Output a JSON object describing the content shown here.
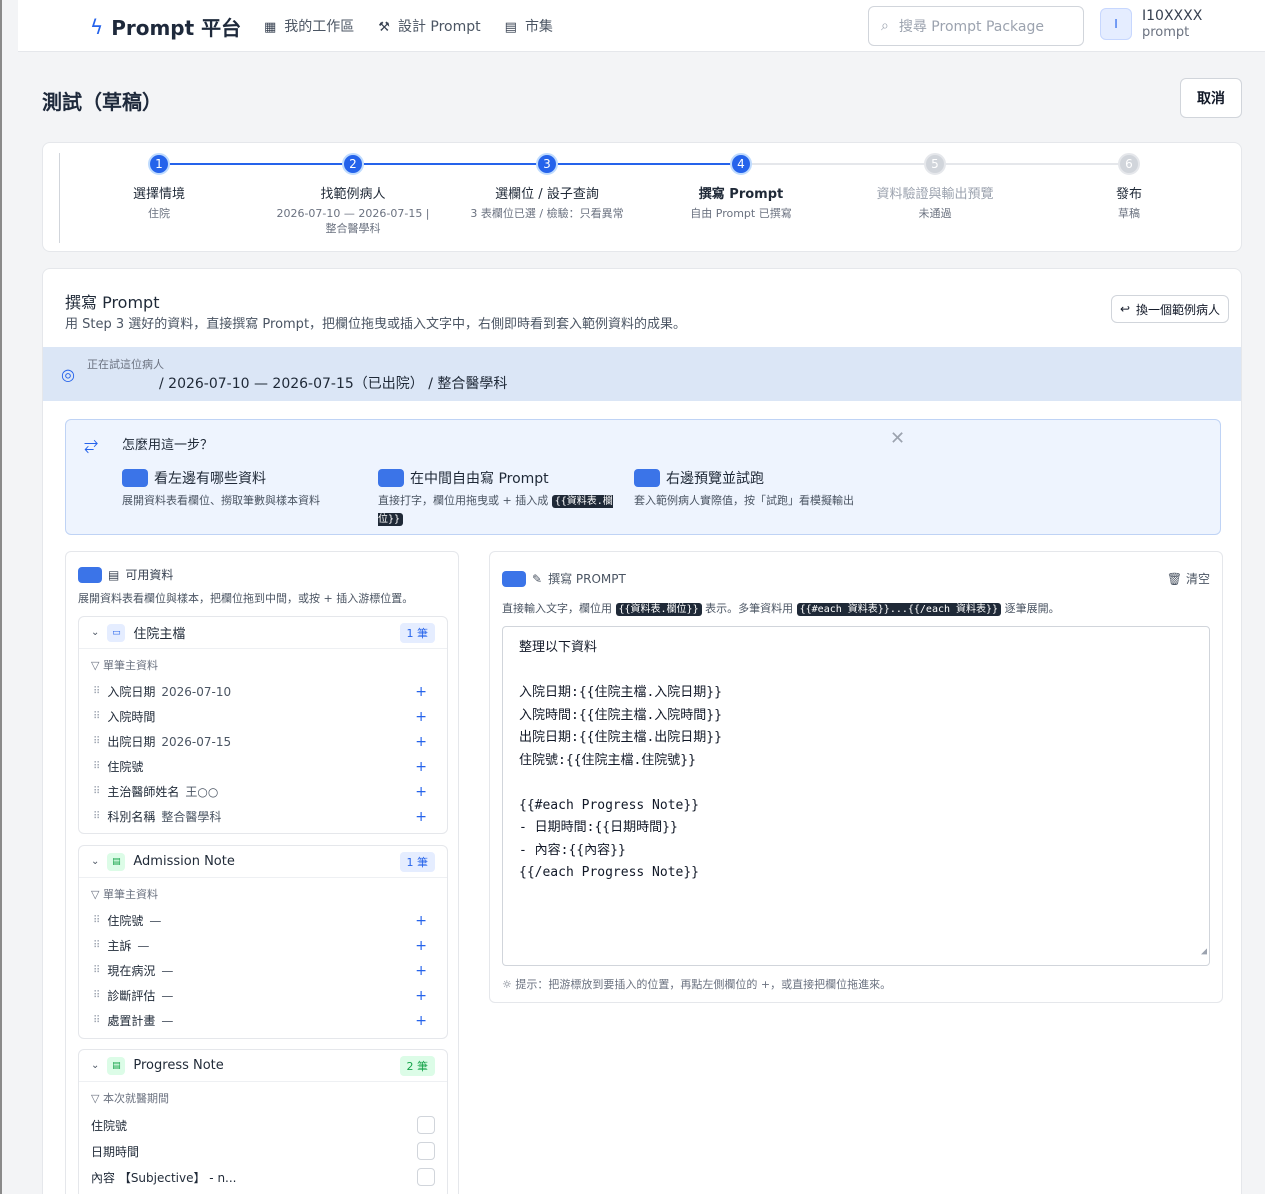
{
  "topbar": {
    "brand": "Prompt 平台",
    "nav": [
      {
        "icon": "grid-icon",
        "glyph": "▦",
        "label": "我的工作區"
      },
      {
        "icon": "wand-icon",
        "glyph": "⚒",
        "label": "設計 Prompt"
      },
      {
        "icon": "store-icon",
        "glyph": "▤",
        "label": "市集"
      }
    ],
    "search_placeholder": "搜尋 Prompt Package",
    "user": {
      "avatar": "I",
      "name": "I10XXXX",
      "role": "prompt"
    }
  },
  "page": {
    "title": "測試（草稿）",
    "cancel": "取消"
  },
  "stepper": {
    "steps": [
      {
        "num": "1",
        "label": "選擇情境",
        "desc": "住院",
        "state": "active"
      },
      {
        "num": "2",
        "label": "找範例病人",
        "desc": "2026-07-10 — 2026-07-15 |\n整合醫學科",
        "state": "active"
      },
      {
        "num": "3",
        "label": "選欄位 / 設子查詢",
        "desc": "3 表欄位已選 / 檢驗：只看異常",
        "state": "active"
      },
      {
        "num": "4",
        "label": "撰寫 Prompt",
        "desc": "自由 Prompt 已撰寫",
        "state": "active"
      },
      {
        "num": "5",
        "label": "資料驗證與輸出預覽",
        "desc": "未通過",
        "state": "idle"
      },
      {
        "num": "6",
        "label": "發布",
        "desc": "草稿",
        "state": "idle"
      }
    ]
  },
  "main": {
    "title": "撰寫 Prompt",
    "desc": "用 Step 3 選好的資料，直接撰寫 Prompt，把欄位拖曳或插入文字中，右側即時看到套入範例資料的成果。",
    "swap_button": "換一個範例病人",
    "patient_label": "正在試這位病人",
    "patient_info": "/ 2026-07-10 — 2026-07-15（已出院） / 整合醫學科"
  },
  "guide": {
    "title": "怎麼用這一步？",
    "items": [
      {
        "title": "看左邊有哪些資料",
        "desc": "展開資料表看欄位、撈取筆數與樣本資料",
        "code": ""
      },
      {
        "title": "在中間自由寫 Prompt",
        "desc": "直接打字，欄位用拖曳或 + 插入成",
        "code": "{{資料表.欄位}}"
      },
      {
        "title": "右邊預覽並試跑",
        "desc": "套入範例病人實際值，按「試跑」看模擬輸出",
        "code": ""
      }
    ]
  },
  "left": {
    "title": "可用資料",
    "desc": "展開資料表看欄位與樣本，把欄位拖到中間，或按 + 插入游標位置。",
    "groups": [
      {
        "name": "住院主檔",
        "count": "1 筆",
        "sub": "單筆主資料",
        "fields": [
          {
            "name": "入院日期",
            "value": "2026-07-10"
          },
          {
            "name": "入院時間",
            "value": ""
          },
          {
            "name": "出院日期",
            "value": "2026-07-15"
          },
          {
            "name": "住院號",
            "value": ""
          },
          {
            "name": "主治醫師姓名",
            "value": "王○○"
          },
          {
            "name": "科別名稱",
            "value": "整合醫學科"
          }
        ]
      },
      {
        "name": "Admission Note",
        "count": "1 筆",
        "sub": "單筆主資料",
        "fields": [
          {
            "name": "住院號",
            "value": "—"
          },
          {
            "name": "主訴",
            "value": "—"
          },
          {
            "name": "現在病況",
            "value": "—"
          },
          {
            "name": "診斷評估",
            "value": "—"
          },
          {
            "name": "處置計畫",
            "value": "—"
          }
        ]
      },
      {
        "name": "Progress Note",
        "count": "2 筆",
        "sub": "本次就醫期間",
        "checks": [
          "住院號",
          "日期時間",
          "內容 【Subjective】 - n..."
        ]
      }
    ]
  },
  "right": {
    "title": "撰寫 PROMPT",
    "clear": "清空",
    "desc_a": "直接輸入文字，欄位用",
    "code_a": "{{資料表.欄位}}",
    "desc_b": "表示。多筆資料用",
    "code_b": "{{#each 資料表}}...{{/each 資料表}}",
    "desc_c": "逐筆展開。",
    "editor": "整理以下資料\n\n入院日期:{{住院主檔.入院日期}}\n入院時間:{{住院主檔.入院時間}}\n出院日期:{{住院主檔.出院日期}}\n住院號:{{住院主檔.住院號}}\n\n{{#each Progress Note}}\n- 日期時間:{{日期時間}}\n- 內容:{{內容}}\n{{/each Progress Note}}",
    "tip": "提示：把游標放到要插入的位置，再點左側欄位的 +，或直接把欄位拖進來。"
  },
  "colors": {
    "accent": "#2563eb",
    "patient_bar": "#dbe6f6",
    "guide_bg": "#eef4fe"
  }
}
